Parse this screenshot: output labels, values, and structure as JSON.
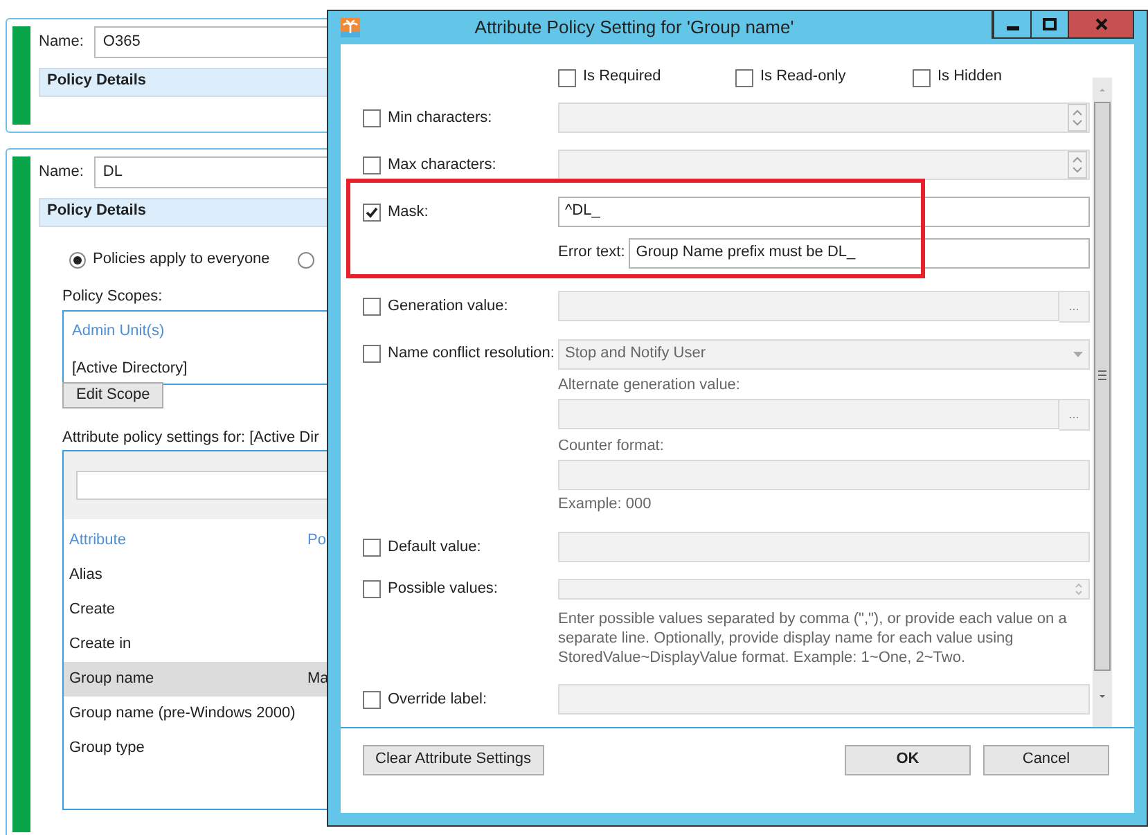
{
  "background": {
    "cards": [
      {
        "name_label": "Name:",
        "name_value": "O365",
        "section": "Policy Details"
      },
      {
        "name_label": "Name:",
        "name_value": "DL",
        "section": "Policy Details",
        "radios": [
          {
            "label": "Policies apply to everyone",
            "selected": true
          },
          {
            "selected": false
          }
        ],
        "scopes_label": "Policy Scopes:",
        "scopes": [
          {
            "kind": "header",
            "text": "Admin Unit(s)"
          },
          {
            "kind": "item",
            "text": "[Active Directory]"
          }
        ],
        "edit_button": "Edit Scope",
        "attributes_label": "Attribute policy settings for: [Active Dir",
        "table": {
          "columns": [
            "Attribute",
            "Po"
          ],
          "rows": [
            {
              "cells": [
                "Alias"
              ],
              "selected": false
            },
            {
              "cells": [
                "Create"
              ],
              "selected": false
            },
            {
              "cells": [
                "Create in"
              ],
              "selected": false
            },
            {
              "cells": [
                "Group name",
                "Ma"
              ],
              "selected": true
            },
            {
              "cells": [
                "Group name (pre-Windows 2000)"
              ],
              "selected": false
            },
            {
              "cells": [
                "Group type"
              ],
              "selected": false
            }
          ]
        }
      }
    ]
  },
  "dialog": {
    "title": "Attribute Policy Setting for 'Group name'",
    "flags": [
      {
        "label": "Is Required",
        "checked": false
      },
      {
        "label": "Is Read-only",
        "checked": false
      },
      {
        "label": "Is Hidden",
        "checked": false
      }
    ],
    "rows": [
      {
        "kind": "spin",
        "label": "Min characters:",
        "checked": false
      },
      {
        "kind": "spin",
        "label": "Max characters:",
        "checked": false
      },
      {
        "kind": "mask",
        "label": "Mask:",
        "checked": true,
        "value": "^DL_",
        "error_label": "Error text:",
        "error_value": "Group Name prefix must be DL_",
        "highlighted": true
      },
      {
        "kind": "browse",
        "label": "Generation value:",
        "checked": false,
        "browse": "..."
      },
      {
        "kind": "conflict",
        "label": "Name conflict resolution:",
        "checked": false,
        "value": "Stop and Notify User",
        "alt_label": "Alternate generation value:",
        "browse": "...",
        "counter_label": "Counter format:",
        "example": "Example: 000"
      },
      {
        "kind": "text",
        "label": "Default value:",
        "checked": false
      },
      {
        "kind": "multi",
        "label": "Possible values:",
        "checked": false,
        "hint": "Enter possible values separated by comma (\",\"), or provide each value on a separate line. Optionally, provide display name for each value using StoredValue~DisplayValue format. Example: 1~One, 2~Two."
      },
      {
        "kind": "text",
        "label": "Override label:",
        "checked": false
      }
    ],
    "buttons": {
      "clear": "Clear Attribute Settings",
      "ok": "OK",
      "cancel": "Cancel"
    }
  }
}
